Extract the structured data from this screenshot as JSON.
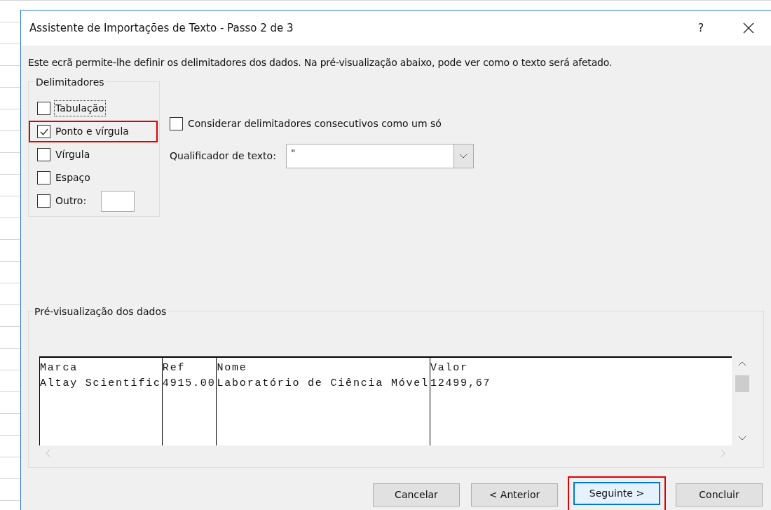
{
  "window": {
    "title": "Assistente de Importações de Texto - Passo 2 de 3",
    "help": "?"
  },
  "description": "Este ecrã permite-lhe definir os delimitadores dos dados. Na pré-visualização abaixo, pode ver como o texto será afetado.",
  "delimiters": {
    "title": "Delimitadores",
    "items": [
      {
        "label": "Tabulação",
        "checked": false,
        "focused": true,
        "highlighted": false,
        "has_field": false
      },
      {
        "label": "Ponto e vírgula",
        "checked": true,
        "focused": false,
        "highlighted": true,
        "has_field": false
      },
      {
        "label": "Vírgula",
        "checked": false,
        "focused": false,
        "highlighted": false,
        "has_field": false
      },
      {
        "label": "Espaço",
        "checked": false,
        "focused": false,
        "highlighted": false,
        "has_field": false
      },
      {
        "label": "Outro:",
        "checked": false,
        "focused": false,
        "highlighted": false,
        "has_field": true
      }
    ]
  },
  "consecutive": {
    "label": "Considerar delimitadores consecutivos como um só",
    "checked": false
  },
  "qualifier": {
    "label": "Qualificador de texto:",
    "value": "\""
  },
  "preview": {
    "title": "Pré-visualização dos dados",
    "rows": [
      [
        "Marca",
        "Ref",
        "Nome",
        "Valor"
      ],
      [
        "Altay Scientific",
        "4915.00",
        "Laboratório de Ciência Móvel",
        "12499,67"
      ]
    ]
  },
  "buttons": [
    {
      "label": "Cancelar",
      "highlighted": false,
      "default": false
    },
    {
      "label": "< Anterior",
      "highlighted": false,
      "default": false
    },
    {
      "label": "Seguinte >",
      "highlighted": true,
      "default": true
    },
    {
      "label": "Concluir",
      "highlighted": false,
      "default": false
    }
  ]
}
